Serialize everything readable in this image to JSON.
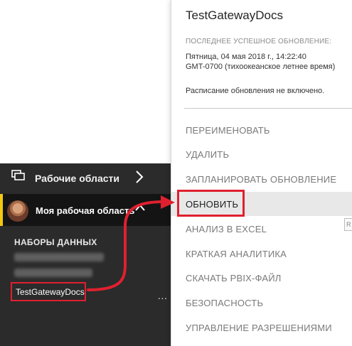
{
  "nav": {
    "workspaces_label": "Рабочие области",
    "my_workspace_label": "Моя рабочая область",
    "datasets_heading": "НАБОРЫ ДАННЫХ",
    "dataset_item": "TestGatewayDocs",
    "ellipsis": "...",
    "accent_color": "#f2c811"
  },
  "flyout": {
    "title": "TestGatewayDocs",
    "last_refresh_heading": "ПОСЛЕДНЕЕ УСПЕШНОЕ ОБНОВЛЕНИЕ:",
    "last_refresh_date": "Пятница, 04 мая 2018 г., 14:22:40",
    "last_refresh_tz": "GMT-0700 (тихоокеанское летнее время)",
    "schedule_note": "Расписание обновления не включено.",
    "menu": [
      {
        "label": "ПЕРЕИМЕНОВАТЬ"
      },
      {
        "label": "УДАЛИТЬ"
      },
      {
        "label": "ЗАПЛАНИРОВАТЬ ОБНОВЛЕНИЕ"
      },
      {
        "label": "ОБНОВИТЬ"
      },
      {
        "label": "АНАЛИЗ В EXCEL"
      },
      {
        "label": "КРАТКАЯ АНАЛИТИКА"
      },
      {
        "label": "СКАЧАТЬ PBIX-ФАЙЛ"
      },
      {
        "label": "БЕЗОПАСНОСТЬ"
      },
      {
        "label": "УПРАВЛЕНИЕ РАЗРЕШЕНИЯМИ"
      }
    ],
    "highlight_color": "#e0202f"
  }
}
